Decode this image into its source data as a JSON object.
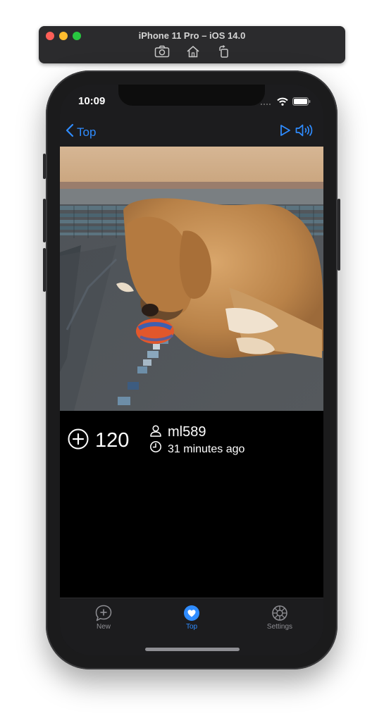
{
  "simulator": {
    "title": "iPhone 11 Pro – iOS 14.0",
    "tools": [
      "screenshot-icon",
      "home-icon",
      "rotate-icon"
    ]
  },
  "status_bar": {
    "time": "10:09"
  },
  "nav": {
    "back_label": "Top",
    "accent_color": "#2f8cff"
  },
  "post": {
    "votes": "120",
    "username": "ml589",
    "time_ago": "31 minutes ago"
  },
  "tabs": [
    {
      "label": "New",
      "icon": "new-bubble-icon",
      "active": false
    },
    {
      "label": "Top",
      "icon": "heart-icon",
      "active": true
    },
    {
      "label": "Settings",
      "icon": "gear-icon",
      "active": false
    }
  ]
}
